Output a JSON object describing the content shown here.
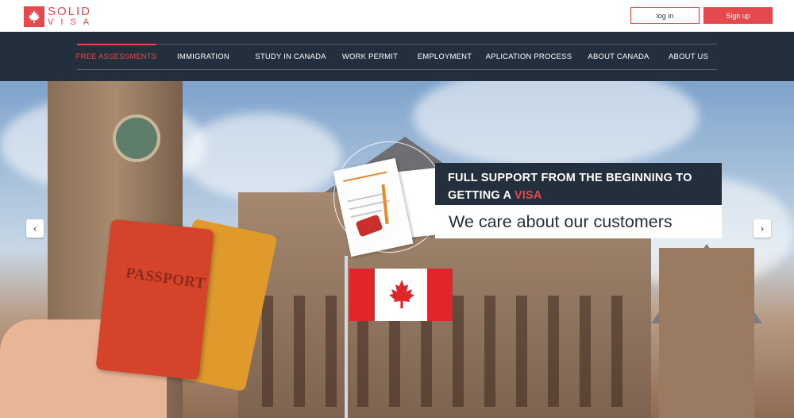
{
  "brand": {
    "name_line1": "SOLID",
    "name_line2": "VISA",
    "accent_color": "#e5484d",
    "logo_icon": "maple-leaf-icon"
  },
  "header": {
    "login_label": "log in",
    "signup_label": "Sign up"
  },
  "nav": {
    "items": [
      {
        "label": "FREE ASSESSMENTS",
        "active": true
      },
      {
        "label": "IMMIGRATION",
        "active": false
      },
      {
        "label": "STUDY IN CANADA",
        "active": false
      },
      {
        "label": "WORK PERMIT",
        "active": false
      },
      {
        "label": "EMPLOYMENT",
        "active": false
      },
      {
        "label": "APLICATION PROCESS",
        "active": false
      },
      {
        "label": "ABOUT CANADA",
        "active": false
      },
      {
        "label": "ABOUT US",
        "active": false
      }
    ],
    "background_color": "#232f3c"
  },
  "hero": {
    "headline_part1": "FULL SUPPORT FROM THE BEGINNING TO",
    "headline_part2": "GETTING A ",
    "headline_accent": "VISA",
    "subheadline": "We care about our customers",
    "passport_text": "PASSPORT",
    "prev_icon": "chevron-left-icon",
    "next_icon": "chevron-right-icon"
  }
}
